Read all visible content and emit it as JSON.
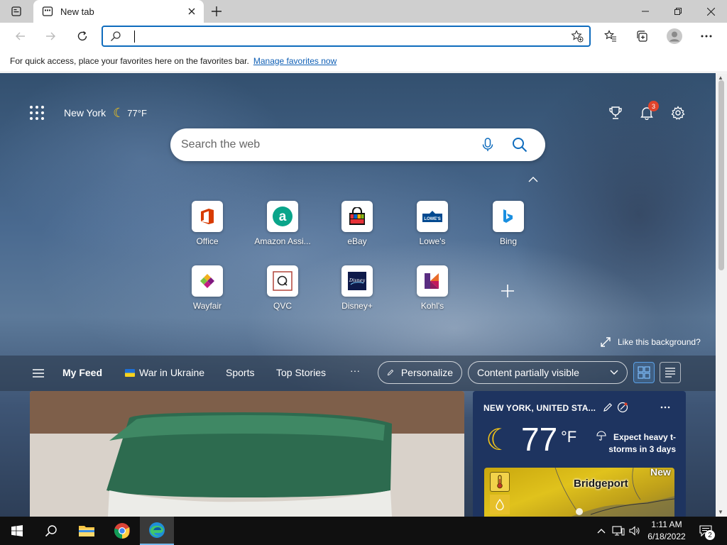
{
  "tab": {
    "title": "New tab"
  },
  "address_bar": {
    "value": "",
    "placeholder": ""
  },
  "favorites_bar": {
    "message": "For quick access, place your favorites here on the favorites bar.",
    "link": "Manage favorites now"
  },
  "ntp": {
    "location": "New York",
    "weather_temp": "77°F",
    "notifications_count": "3",
    "search_placeholder": "Search the web",
    "quick_links": [
      {
        "label": "Office",
        "icon": "office-icon"
      },
      {
        "label": "Amazon Assi...",
        "icon": "amazon-icon"
      },
      {
        "label": "eBay",
        "icon": "ebay-icon"
      },
      {
        "label": "Lowe's",
        "icon": "lowes-icon"
      },
      {
        "label": "Bing",
        "icon": "bing-icon"
      },
      {
        "label": "Wayfair",
        "icon": "wayfair-icon"
      },
      {
        "label": "QVC",
        "icon": "qvc-icon"
      },
      {
        "label": "Disney+",
        "icon": "disney-icon"
      },
      {
        "label": "Kohl's",
        "icon": "kohls-icon"
      }
    ],
    "like_background": "Like this background?"
  },
  "feed_nav": {
    "items": [
      "My Feed",
      "War in Ukraine",
      "Sports",
      "Top Stories"
    ],
    "more": "···",
    "personalize": "Personalize",
    "content_visibility": "Content partially visible"
  },
  "weather_card": {
    "location": "NEW YORK, UNITED STA...",
    "temp": "77",
    "unit": "°F",
    "alert": "Expect heavy t-storms in 3 days",
    "map_city": "Bridgeport",
    "map_city2": "New"
  },
  "taskbar": {
    "time": "1:11 AM",
    "date": "6/18/2022",
    "notification_count": "2"
  },
  "colors": {
    "accent": "#0f6cbd",
    "weather_card_bg": "#1e3460",
    "taskbar_bg": "#101010",
    "badge_red": "#e0432b"
  }
}
